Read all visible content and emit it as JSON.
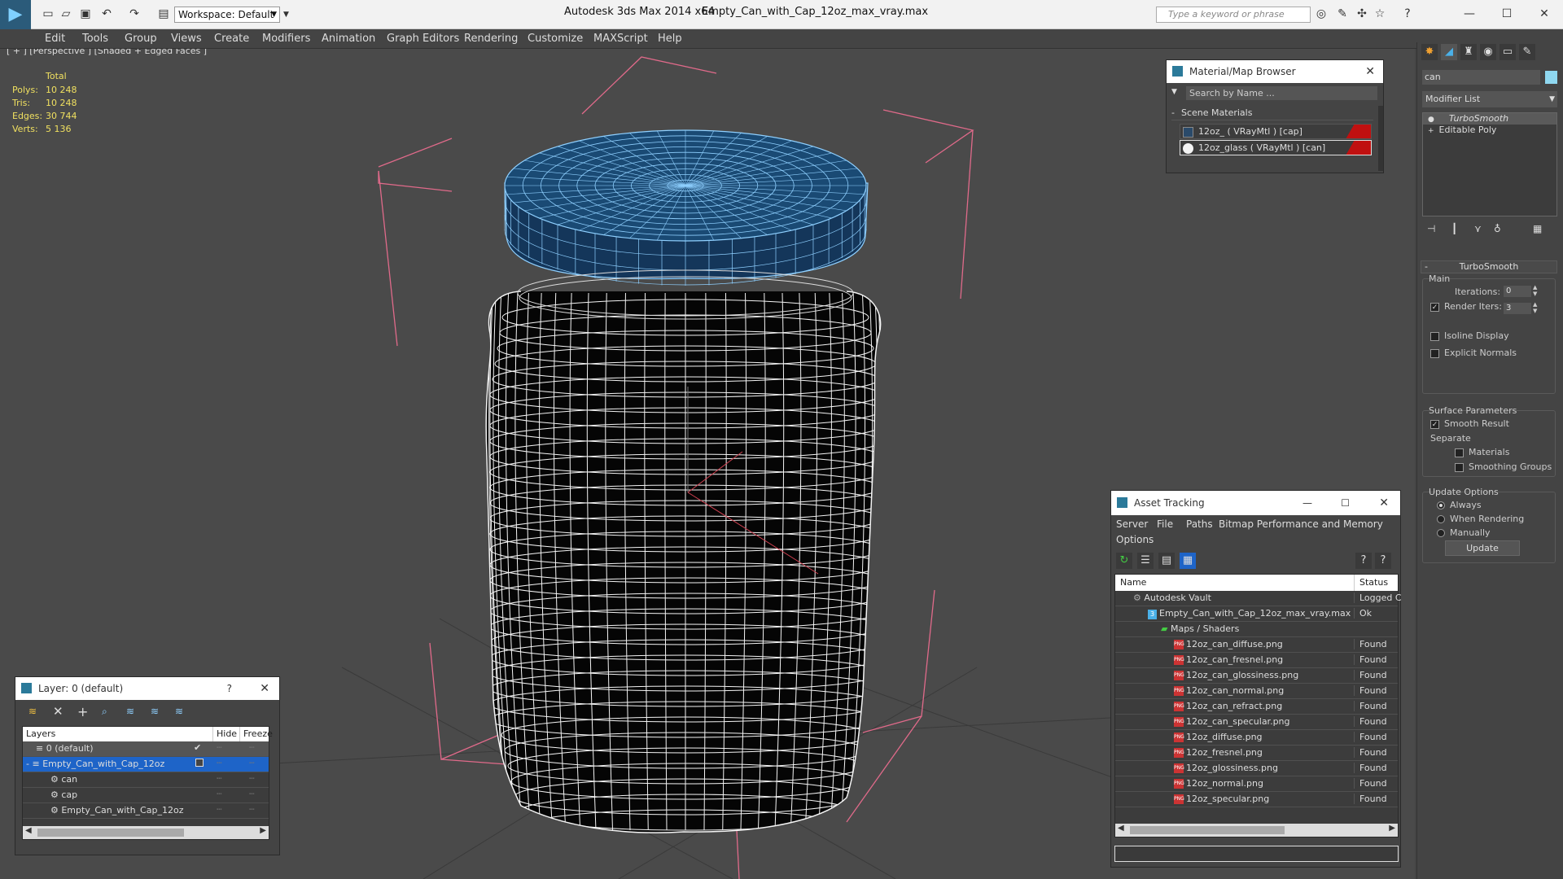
{
  "titlebar": {
    "app_title": "Autodesk 3ds Max  2014 x64",
    "file_title": "Empty_Can_with_Cap_12oz_max_vray.max",
    "workspace": "Workspace: Default",
    "search_placeholder": "Type a keyword or phrase"
  },
  "menu": [
    "Edit",
    "Tools",
    "Group",
    "Views",
    "Create",
    "Modifiers",
    "Animation",
    "Graph Editors",
    "Rendering",
    "Customize",
    "MAXScript",
    "Help"
  ],
  "viewport": {
    "label": "[ + ] [Perspective ] [Shaded + Edged Faces ]",
    "stats_header": "Total",
    "stats": [
      {
        "label": "Polys:",
        "value": "10 248"
      },
      {
        "label": "Tris:",
        "value": "10 248"
      },
      {
        "label": "Edges:",
        "value": "30 744"
      },
      {
        "label": "Verts:",
        "value": "5 136"
      }
    ]
  },
  "material_browser": {
    "title": "Material/Map Browser",
    "search_placeholder": "Search by Name ...",
    "section": "Scene Materials",
    "items": [
      "12oz_  ( VRayMtl ) [cap]",
      "12oz_glass  ( VRayMtl ) [can]"
    ]
  },
  "command_panel": {
    "name_field": "can",
    "modifier_list": "Modifier List",
    "stack": [
      "TurboSmooth",
      "Editable Poly"
    ],
    "rollout_title": "TurboSmooth",
    "main_label": "Main",
    "iterations_label": "Iterations:",
    "iterations_value": "0",
    "render_iters_label": "Render Iters:",
    "render_iters_value": "3",
    "isoline_label": "Isoline Display",
    "explicit_normals_label": "Explicit Normals",
    "surface_params_label": "Surface Parameters",
    "smooth_result_label": "Smooth Result",
    "separate_label": "Separate",
    "materials_label": "Materials",
    "smoothing_groups_label": "Smoothing Groups",
    "update_options_label": "Update Options",
    "always_label": "Always",
    "when_rendering_label": "When Rendering",
    "manually_label": "Manually",
    "update_button": "Update"
  },
  "layer_panel": {
    "title": "Layer: 0 (default)",
    "help": "?",
    "col_layers": "Layers",
    "col_hide": "Hide",
    "col_freeze": "Freeze",
    "rows": [
      "0 (default)",
      "Empty_Can_with_Cap_12oz",
      "can",
      "cap",
      "Empty_Can_with_Cap_12oz"
    ]
  },
  "asset_tracking": {
    "title": "Asset Tracking",
    "menu": [
      "Server",
      "File",
      "Paths",
      "Bitmap Performance and Memory",
      "Options"
    ],
    "col_name": "Name",
    "col_status": "Status",
    "vault": {
      "name": "Autodesk Vault",
      "status": "Logged C"
    },
    "file": {
      "name": "Empty_Can_with_Cap_12oz_max_vray.max",
      "status": "Ok"
    },
    "maps_folder": "Maps / Shaders",
    "files": [
      {
        "name": "12oz_can_diffuse.png",
        "status": "Found"
      },
      {
        "name": "12oz_can_fresnel.png",
        "status": "Found"
      },
      {
        "name": "12oz_can_glossiness.png",
        "status": "Found"
      },
      {
        "name": "12oz_can_normal.png",
        "status": "Found"
      },
      {
        "name": "12oz_can_refract.png",
        "status": "Found"
      },
      {
        "name": "12oz_can_specular.png",
        "status": "Found"
      },
      {
        "name": "12oz_diffuse.png",
        "status": "Found"
      },
      {
        "name": "12oz_fresnel.png",
        "status": "Found"
      },
      {
        "name": "12oz_glossiness.png",
        "status": "Found"
      },
      {
        "name": "12oz_normal.png",
        "status": "Found"
      },
      {
        "name": "12oz_specular.png",
        "status": "Found"
      }
    ],
    "png_badge": "PNG"
  },
  "colors": {
    "selection": "#1e64c8",
    "cap_wire": "#8fd0ff",
    "bbox": "#e06a8a",
    "accent": "#4ab0e8"
  }
}
